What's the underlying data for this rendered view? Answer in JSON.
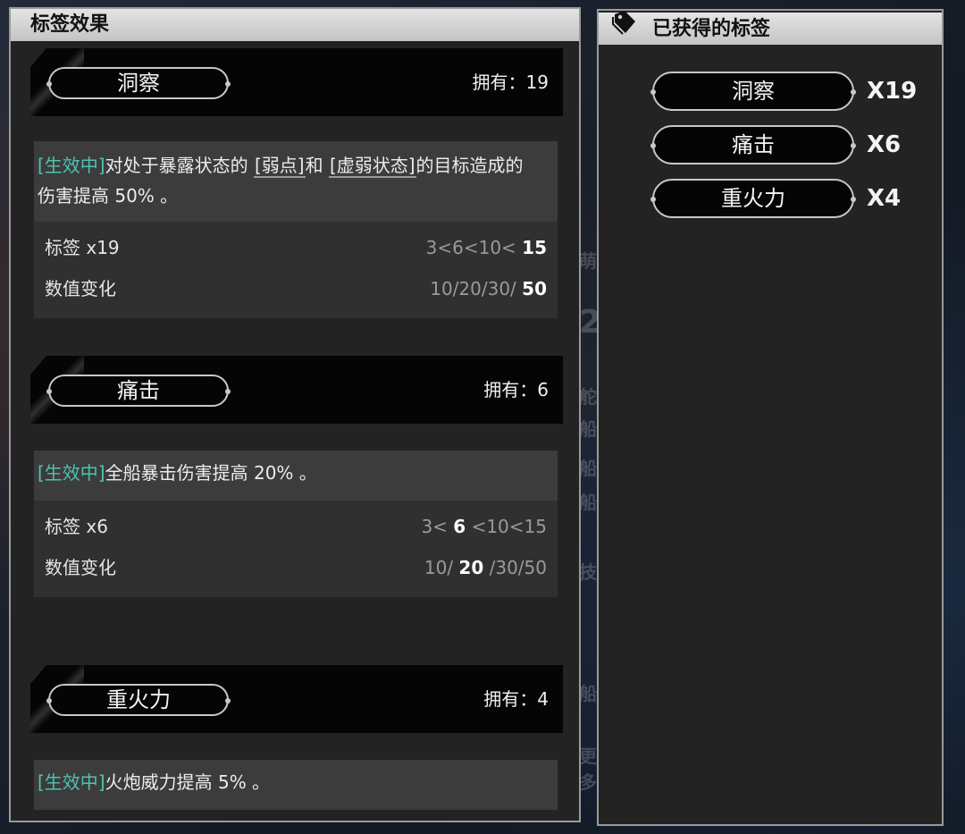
{
  "effects_panel": {
    "title": "标签效果",
    "sections": [
      {
        "name": "洞察",
        "owned": "拥有：19",
        "desc_prefix": "[生效中]",
        "desc_text": "对处于暴露状态的",
        "kw1": "[弱点]",
        "desc_mid": "和",
        "kw2": "[虚弱状态]",
        "desc_tail": "的目标造成的",
        "desc_line2": "伤害提高 50% 。",
        "stats": [
          {
            "label": "标签 x19",
            "pre": "3<6<10< ",
            "current": "15",
            "post": ""
          },
          {
            "label": "数值变化",
            "pre": "10/20/30/ ",
            "current": "50",
            "post": ""
          }
        ]
      },
      {
        "name": "痛击",
        "owned": "拥有：6",
        "desc_prefix": "[生效中]",
        "desc_text": "全船暴击伤害提高 20% 。",
        "stats": [
          {
            "label": "标签 x6",
            "pre": "3< ",
            "current": "6",
            "post": " <10<15"
          },
          {
            "label": "数值变化",
            "pre": "10/ ",
            "current": "20",
            "post": " /30/50"
          }
        ]
      },
      {
        "name": "重火力",
        "owned": "拥有：4",
        "desc_prefix": "[生效中]",
        "desc_text": "火炮威力提高 5% 。"
      }
    ]
  },
  "owned_panel": {
    "title": "已获得的标签",
    "icon": "tag-icon",
    "items": [
      {
        "name": "洞察",
        "count": "X19"
      },
      {
        "name": "痛击",
        "count": "X6"
      },
      {
        "name": "重火力",
        "count": "X4"
      }
    ]
  },
  "background_glyphs": [
    "萌",
    "2",
    "舵",
    "船",
    "船",
    "船",
    "技",
    "船",
    "更多"
  ],
  "colors": {
    "active": "#4fc2b0",
    "panel": "#232323",
    "header": "#d6d6d6"
  }
}
